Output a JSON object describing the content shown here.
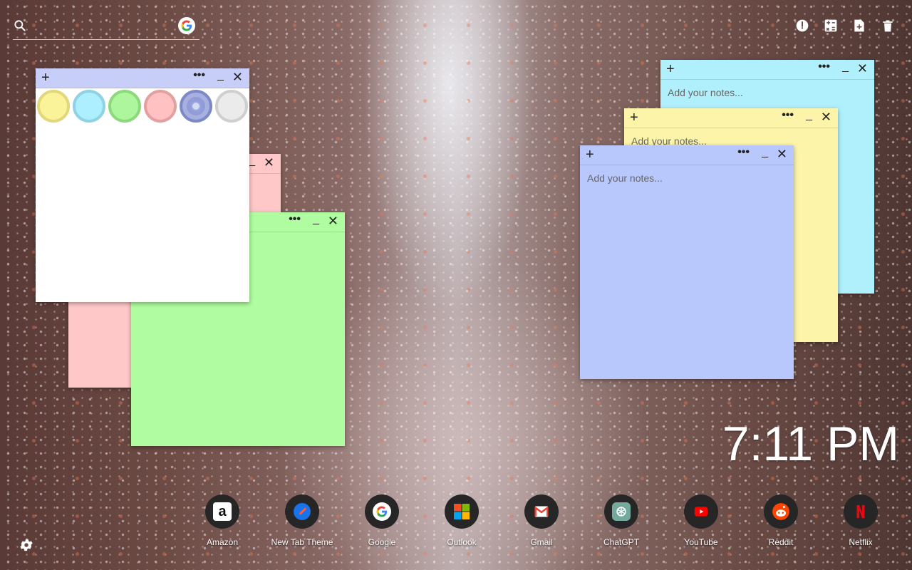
{
  "search": {
    "placeholder": "",
    "engine_icon": "google-g-icon"
  },
  "toolbar": {
    "items": [
      "timer-icon",
      "calculator-icon",
      "new-note-icon",
      "trash-icon"
    ]
  },
  "notes": [
    {
      "id": "white",
      "color": "#ffffff",
      "header_color": "#c7cff8",
      "placeholder": "",
      "is_color_picker": true
    },
    {
      "id": "pink",
      "color": "#ffc8c8",
      "placeholder": ""
    },
    {
      "id": "green",
      "color": "#b0fca0",
      "placeholder": ""
    },
    {
      "id": "cyan",
      "color": "#b0f0fc",
      "placeholder": "Add your notes..."
    },
    {
      "id": "yellow",
      "color": "#fcf4a8",
      "placeholder": "Add your notes..."
    },
    {
      "id": "blue",
      "color": "#b8c8fc",
      "placeholder": "Add your notes..."
    }
  ],
  "color_swatches": [
    {
      "name": "yellow",
      "fill": "#fbf39a",
      "border": "#e2d77a"
    },
    {
      "name": "cyan",
      "fill": "#aeefff",
      "border": "#8fd2e4"
    },
    {
      "name": "green",
      "fill": "#aef69e",
      "border": "#8cd87c"
    },
    {
      "name": "pink",
      "fill": "#ffc1c1",
      "border": "#e3a0a0"
    },
    {
      "name": "indigo",
      "fill": "#9aa6e4",
      "border": "#7d89c6",
      "selected": true
    },
    {
      "name": "gray",
      "fill": "#ebebeb",
      "border": "#cfcfcf"
    }
  ],
  "clock": {
    "time": "7:11 PM"
  },
  "shortcuts": [
    {
      "label": "Amazon",
      "icon": "amazon-icon"
    },
    {
      "label": "New Tab Theme",
      "icon": "new-tab-theme-icon"
    },
    {
      "label": "Google",
      "icon": "google-icon"
    },
    {
      "label": "Outlook",
      "icon": "microsoft-icon"
    },
    {
      "label": "Gmail",
      "icon": "gmail-icon"
    },
    {
      "label": "ChatGPT",
      "icon": "chatgpt-icon"
    },
    {
      "label": "YouTube",
      "icon": "youtube-icon"
    },
    {
      "label": "Reddit",
      "icon": "reddit-icon"
    },
    {
      "label": "Netflix",
      "icon": "netflix-icon"
    }
  ],
  "note_controls": {
    "add": "+",
    "more": "•••",
    "minimize": "_",
    "close": "✕"
  }
}
